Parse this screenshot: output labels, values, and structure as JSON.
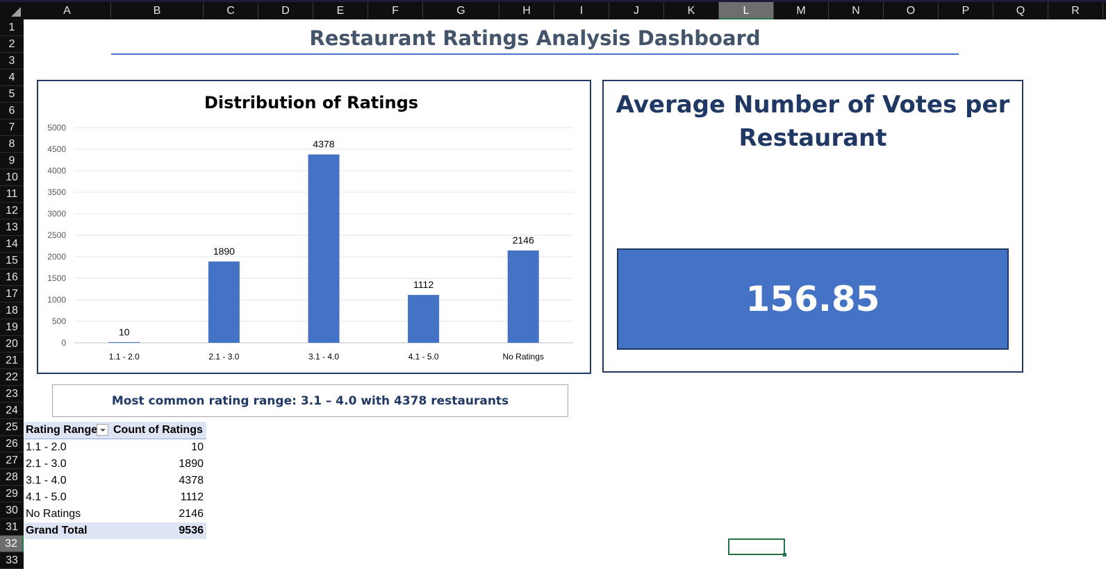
{
  "sheet": {
    "columns": [
      "A",
      "B",
      "C",
      "D",
      "E",
      "F",
      "G",
      "H",
      "I",
      "J",
      "K",
      "L",
      "M",
      "N",
      "O",
      "P",
      "Q",
      "R"
    ],
    "rows": [
      "1",
      "2",
      "3",
      "4",
      "5",
      "6",
      "7",
      "8",
      "9",
      "10",
      "11",
      "12",
      "13",
      "14",
      "15",
      "16",
      "17",
      "18",
      "19",
      "20",
      "21",
      "22",
      "23",
      "24",
      "25",
      "26",
      "27",
      "28",
      "29",
      "30",
      "31",
      "32",
      "33"
    ],
    "selected_column": "L",
    "selected_row": "32"
  },
  "dashboard": {
    "title": "Restaurant Ratings Analysis Dashboard",
    "kpi_title": "Average Number of Votes per Restaurant",
    "kpi_value": "156.85",
    "note": "Most common rating range: 3.1 – 4.0 with 4378 restaurants"
  },
  "chart_data": {
    "type": "bar",
    "title": "Distribution of Ratings",
    "categories": [
      "1.1 - 2.0",
      "2.1 - 3.0",
      "3.1 - 4.0",
      "4.1 - 5.0",
      "No Ratings"
    ],
    "values": [
      10,
      1890,
      4378,
      1112,
      2146
    ],
    "y_ticks": [
      "0",
      "500",
      "1000",
      "1500",
      "2000",
      "2500",
      "3000",
      "3500",
      "4000",
      "4500",
      "5000"
    ],
    "ylim": [
      0,
      5000
    ],
    "grid": true,
    "data_labels": true,
    "bar_color": "#4472c4"
  },
  "pivot": {
    "headers": [
      "Rating Range",
      "Count of Ratings"
    ],
    "rows": [
      {
        "label": "1.1 - 2.0",
        "value": "10"
      },
      {
        "label": "2.1 - 3.0",
        "value": "1890"
      },
      {
        "label": "3.1 - 4.0",
        "value": "4378"
      },
      {
        "label": "4.1 - 5.0",
        "value": "1112"
      },
      {
        "label": "No Ratings",
        "value": "2146"
      }
    ],
    "total_label": "Grand Total",
    "total_value": "9536"
  }
}
